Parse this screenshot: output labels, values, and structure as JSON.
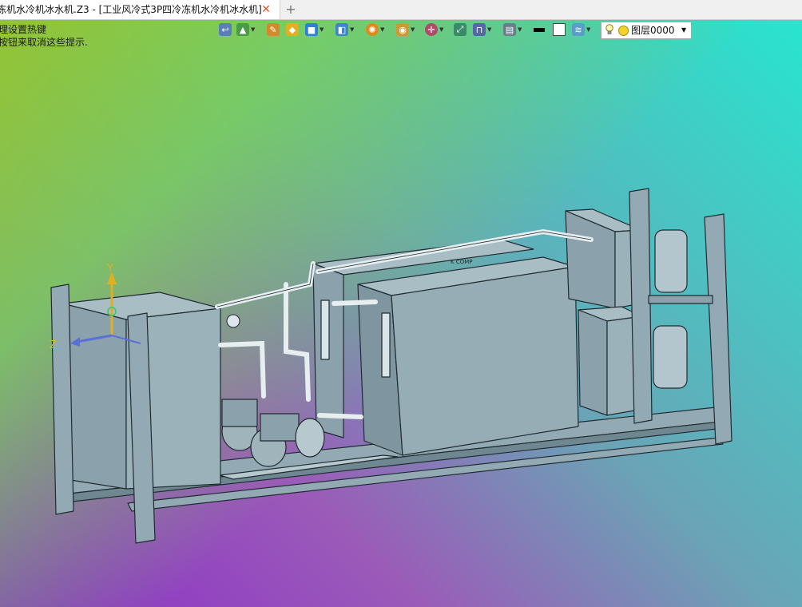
{
  "tabs": [
    {
      "title": "冻机水冷机冰水机.Z3 - [工业风冷式3P四冷冻机水冷机冰水机]",
      "close_label": "✕",
      "active": true
    }
  ],
  "new_tab_label": "+",
  "hints": [
    "理设置热键",
    "按钮来取消这些提示."
  ],
  "toolbar": {
    "icons": [
      "back-arrow-icon",
      "paint-icon",
      "pencil-icon",
      "solid-shape-icon",
      "cube-icon",
      "view-cube-icon",
      "render-icon",
      "texture-icon",
      "axis-icon",
      "fit-view-icon",
      "section-icon",
      "display-icon",
      "line-color-icon",
      "fill-color-icon",
      "layer-stack-icon"
    ]
  },
  "layer": {
    "name": "图层0000"
  },
  "axes": {
    "y": "Y",
    "z": "Z"
  },
  "model_label": "K COMP",
  "colors": {
    "model_fill": "#93aab4",
    "model_dark": "#6f8790",
    "model_edge": "#1f2b30",
    "pipe": "#e6eef0"
  }
}
